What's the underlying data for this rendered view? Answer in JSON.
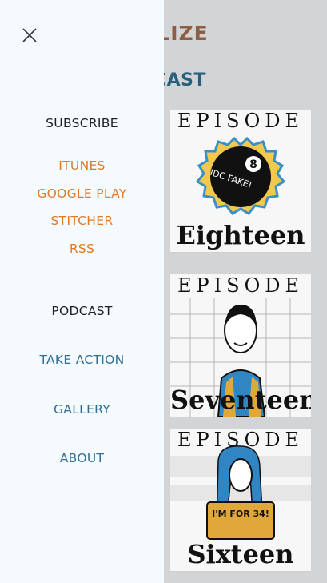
{
  "background": {
    "logo_fragment": "ILIZE",
    "subtitle_fragment": "CAST",
    "episodes": [
      {
        "top": "EPISODE",
        "bottom": "Eighteen",
        "art": "eight-ball-icon",
        "ball_text": "IDC FAKE!"
      },
      {
        "top": "EPISODE",
        "bottom": "Seventeen",
        "art": "woman-portrait-icon"
      },
      {
        "top": "EPISODE",
        "bottom": "Sixteen",
        "art": "woman-with-sign-icon",
        "sign_text": "I'M FOR 34!"
      }
    ]
  },
  "menu": {
    "close_icon": "close-icon",
    "subscribe_heading": "SUBSCRIBE",
    "subscribe_links": [
      "ITUNES",
      "GOOGLE PLAY",
      "STITCHER",
      "RSS"
    ],
    "podcast": "PODCAST",
    "take_action": "TAKE ACTION",
    "gallery": "GALLERY",
    "about": "ABOUT"
  },
  "colors": {
    "drawer_bg": "#f4fafd",
    "link_orange": "#e07a24",
    "link_teal": "#2f6f96",
    "heading_dark": "#1f1f1f",
    "logo_brown": "#8a5f43"
  }
}
